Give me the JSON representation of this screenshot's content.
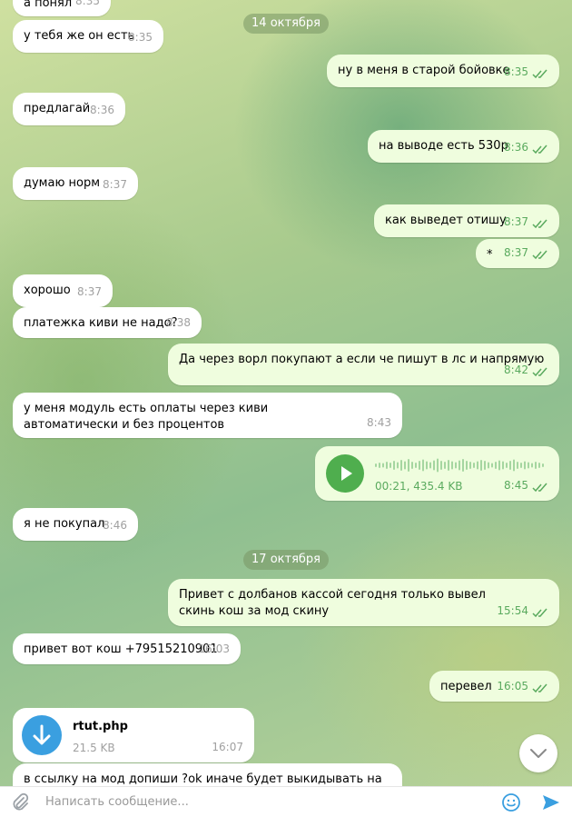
{
  "messages": [
    {
      "text": "а понял",
      "time": "8:35"
    },
    {
      "text": "у тебя же он есть",
      "time": "8:35"
    },
    {
      "text": "ну в меня в старой бойовке",
      "time": "8:35"
    },
    {
      "text": "предлагай",
      "time": "8:36"
    },
    {
      "text": "на выводе есть 530р",
      "time": "8:36"
    },
    {
      "text": "думаю норм",
      "time": "8:37"
    },
    {
      "text": "как выведет отишу",
      "time": "8:37"
    },
    {
      "text": "*",
      "time": "8:37"
    },
    {
      "text": "хорошо",
      "time": "8:37"
    },
    {
      "text": "платежка киви не надо?",
      "time": "8:38"
    },
    {
      "text": "Да через ворл покупают а если че пишут в лс и напрямую",
      "time": "8:42"
    },
    {
      "text": "у меня модуль есть оплаты через киви автоматически и без процентов",
      "time": "8:43"
    },
    {
      "text": "я не покупал",
      "time": "8:46"
    },
    {
      "text": "Привет с долбанов кассой сегодня только вывел скинь кош за мод скину",
      "time": "15:54"
    },
    {
      "text": "привет вот кош +79515210901",
      "time": "16:03"
    },
    {
      "text": "перевел",
      "time": "16:05"
    },
    {
      "text": "в ссылку на мод допиши ?ok иначе будет выкидывать на"
    }
  ],
  "dates": {
    "first": "14 октября",
    "second": "17 октября"
  },
  "voice": {
    "meta": "00:21, 435.4 KB",
    "time": "8:45",
    "progress": 0
  },
  "file": {
    "name": "rtut.php",
    "size": "21.5 KB",
    "time": "16:07"
  },
  "composer": {
    "placeholder": "Написать сообщение..."
  },
  "icons": {
    "check": "double-check-icon",
    "play": "play-icon",
    "download": "download-arrow-icon",
    "attach": "paperclip-icon",
    "emoji": "smile-icon",
    "send": "send-icon",
    "scroll": "chevron-down-icon"
  },
  "colors": {
    "accent": "#4fae4e",
    "link": "#3a9fe0",
    "outgoing_bg": "#effdde",
    "incoming_bg": "#ffffff"
  }
}
